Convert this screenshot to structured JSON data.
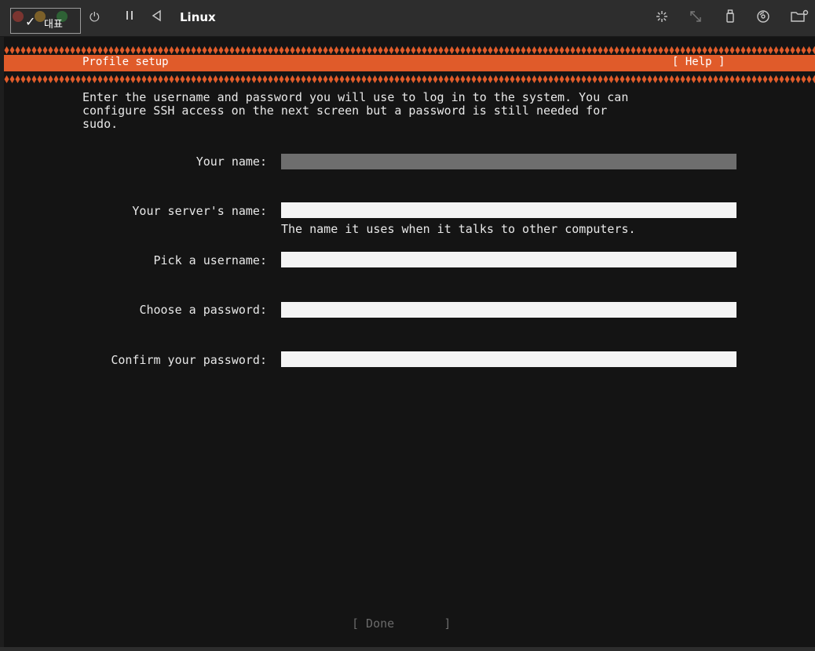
{
  "badge": {
    "label": "대표"
  },
  "window": {
    "title": "Linux"
  },
  "toolbar_icons": [
    "power-icon",
    "pause-icon",
    "back-icon",
    "sparkle-icon",
    "resize-icon",
    "usb-icon",
    "disc-icon",
    "folder-icon"
  ],
  "header": {
    "title": "Profile setup",
    "help": "[ Help ]"
  },
  "intro": {
    "line1": "Enter the username and password you will use to log in to the system. You can",
    "line2": "configure SSH access on the next screen but a password is still needed for",
    "line3": "sudo."
  },
  "form": {
    "name_label": "Your name:",
    "server_label": "Your server's name:",
    "server_hint": "The name it uses when it talks to other computers.",
    "username_label": "Pick a username:",
    "password_label": "Choose a password:",
    "confirm_label": "Confirm your password:"
  },
  "done": {
    "label": "[ Done       ]"
  },
  "colors": {
    "accent": "#e05b2a",
    "screen_bg": "#141414",
    "field_bg": "#f4f4f4",
    "field_active": "#6e6e6e"
  }
}
